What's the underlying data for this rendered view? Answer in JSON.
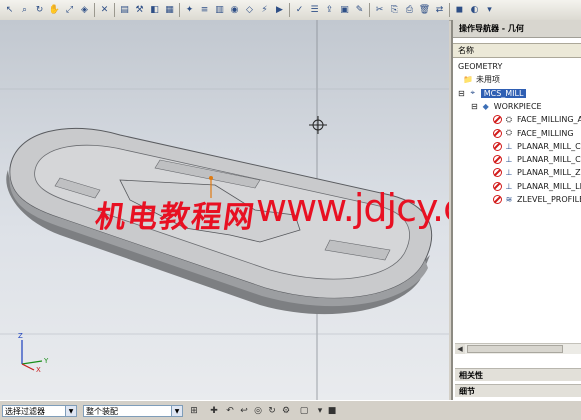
{
  "toolbar": {
    "icons": [
      "select-icon",
      "zoom-icon",
      "rotate-icon",
      "pan-icon",
      "fit-icon",
      "orient-icon",
      "close-icon",
      "create-program-icon",
      "create-tool-icon",
      "create-geometry-icon",
      "create-method-icon",
      "create-operation-icon",
      "program-view-icon",
      "machine-tool-view-icon",
      "geometry-view-icon",
      "method-view-icon",
      "generate-icon",
      "replay-icon",
      "verify-icon",
      "list-icon",
      "postprocess-icon",
      "shop-doc-icon",
      "edit-icon",
      "cut-icon",
      "copy-icon",
      "paste-icon",
      "delete-icon",
      "transform-icon",
      "object-icon",
      "display-icon",
      "more-icon"
    ]
  },
  "watermark": {
    "chinese": "机电教程网",
    "url": "www.jdjcy.com"
  },
  "navigator": {
    "title": "操作导航器 - 几何",
    "column_header": "名称",
    "items": [
      {
        "label": "GEOMETRY",
        "icon": "",
        "selected": false
      },
      {
        "label": "未用项",
        "icon": "unused-folder-icon",
        "selected": false
      },
      {
        "label": "MCS_MILL",
        "icon": "mcs-icon",
        "selected": true
      },
      {
        "label": "WORKPIECE",
        "icon": "workpiece-icon",
        "selected": false
      },
      {
        "label": "FACE_MILLING_A",
        "icon": "face-milling-icon",
        "selected": false
      },
      {
        "label": "FACE_MILLING",
        "icon": "face-milling-icon",
        "selected": false
      },
      {
        "label": "PLANAR_MILL_C",
        "icon": "planar-mill-icon",
        "selected": false
      },
      {
        "label": "PLANAR_MILL_C",
        "icon": "planar-mill-icon",
        "selected": false
      },
      {
        "label": "PLANAR_MILL_ZI",
        "icon": "planar-mill-icon",
        "selected": false
      },
      {
        "label": "PLANAR_MILL_LL",
        "icon": "planar-mill-icon",
        "selected": false
      },
      {
        "label": "ZLEVEL_PROFILE",
        "icon": "zlevel-icon",
        "selected": false
      }
    ],
    "sections": {
      "dependencies": "相关性",
      "details": "细节"
    }
  },
  "statusbar": {
    "filter_value": "选择过滤器",
    "assembly_value": "整个装配"
  },
  "triad": {
    "x": "X",
    "y": "Y",
    "z": "Z"
  },
  "colors": {
    "selection": "#2f5fb3",
    "watermark": "#e81022",
    "error": "#d21a1a"
  }
}
